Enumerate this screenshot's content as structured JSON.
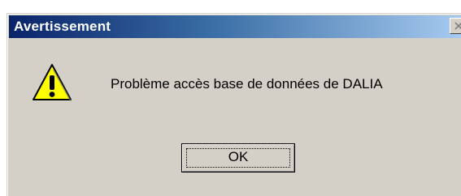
{
  "window": {
    "title": "Avertissement",
    "close_icon": "close-icon"
  },
  "message": {
    "icon": "warning-icon",
    "text": "Problème accès base de données de DALIA"
  },
  "buttons": {
    "ok_label": "OK"
  },
  "colors": {
    "titlebar_start": "#0a246a",
    "titlebar_end": "#a6caf0",
    "dialog_bg": "#d4d0c8",
    "warning_yellow": "#ffff00"
  }
}
